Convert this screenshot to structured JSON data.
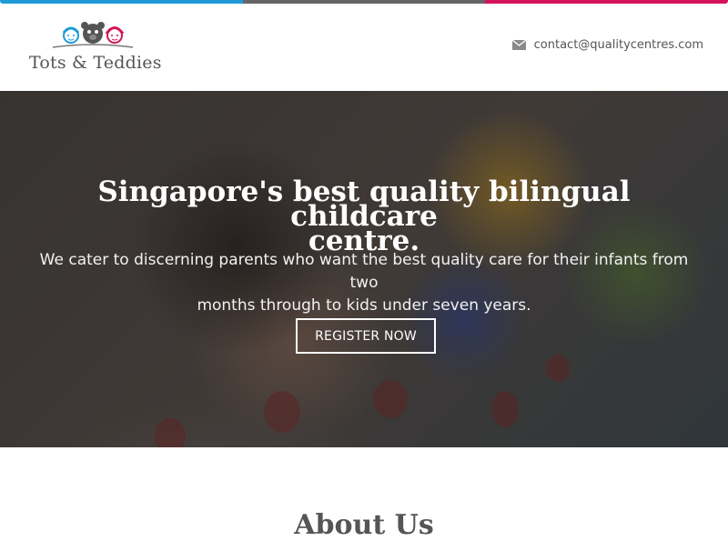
{
  "brand": {
    "logo_text": "Tots & Teddies",
    "colors": {
      "blue": "#1e9bd7",
      "grey": "#666666",
      "pink": "#d4145a"
    }
  },
  "header": {
    "contact_icon": "envelope-icon",
    "contact_email": "contact@qualitycentres.com"
  },
  "hero": {
    "title_line1": "Singapore's best quality bilingual childcare",
    "title_line2": "centre.",
    "subtitle_line1": "We cater to discerning parents who want the best quality care for their infants from two",
    "subtitle_line2": "months through to kids under seven years.",
    "cta_label": "REGISTER NOW"
  },
  "about": {
    "heading": "About Us"
  }
}
